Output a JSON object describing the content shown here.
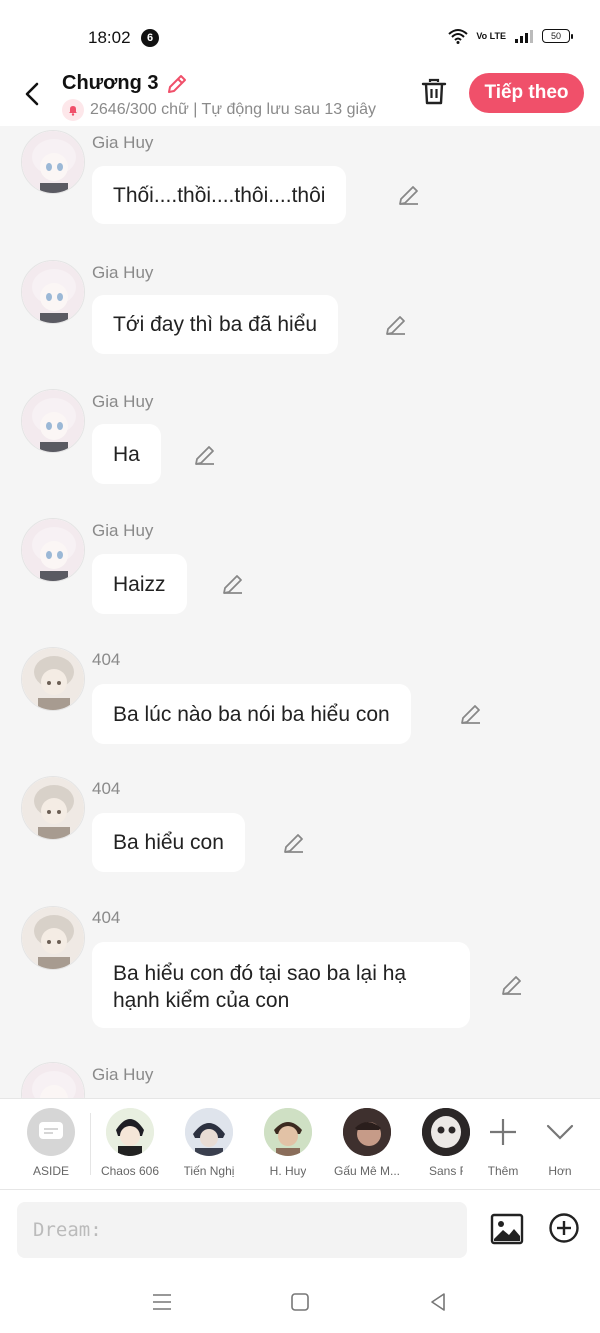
{
  "status_bar": {
    "time": "18:02",
    "notification_count": "6",
    "network": "Vo LTE",
    "battery": "50"
  },
  "header": {
    "title": "Chương 3",
    "word_count": "2646/300 chữ | Tự động lưu sau 13 giây",
    "next_button": "Tiếp theo"
  },
  "messages": [
    {
      "name": "Gia Huy",
      "text": "Thối....thồi....thôi....thôi"
    },
    {
      "name": "Gia Huy",
      "text": "Tới đay thì ba đã hiểu"
    },
    {
      "name": "Gia Huy",
      "text": "Ha"
    },
    {
      "name": "Gia Huy",
      "text": "Haizz"
    },
    {
      "name": "404",
      "text": "Ba lúc nào ba nói ba hiểu con"
    },
    {
      "name": "404",
      "text": "Ba hiểu con"
    },
    {
      "name": "404",
      "text": "Ba hiểu con đó tại sao ba lại hạ hạnh kiểm của con"
    },
    {
      "name": "Gia Huy",
      "text": ""
    }
  ],
  "characters": [
    {
      "label": "ASIDE",
      "icon": "aside-icon"
    },
    {
      "label": "Chaos 606",
      "icon": "avatar"
    },
    {
      "label": "Tiến Nghị",
      "icon": "avatar"
    },
    {
      "label": "H. Huy",
      "icon": "avatar"
    },
    {
      "label": "Gấu Mê M...",
      "icon": "avatar"
    },
    {
      "label": "Sans F",
      "icon": "avatar"
    },
    {
      "label": "Thêm",
      "icon": "plus-icon"
    },
    {
      "label": "Hơn",
      "icon": "chevron-down-icon"
    }
  ],
  "input": {
    "placeholder": "Dream:"
  },
  "colors": {
    "accent": "#f0506a",
    "background": "#f5f5f5",
    "bubble": "#ffffff"
  }
}
